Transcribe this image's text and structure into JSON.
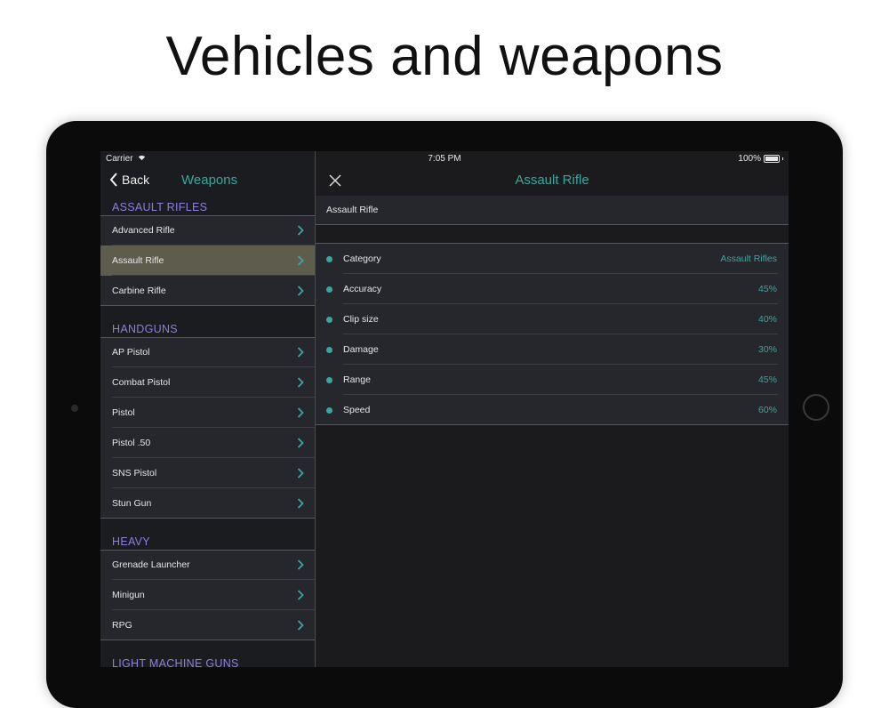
{
  "headline": "Vehicles and weapons",
  "status": {
    "carrier": "Carrier",
    "time": "7:05 PM",
    "battery": "100%"
  },
  "master": {
    "back_label": "Back",
    "title": "Weapons",
    "sections": [
      {
        "header": "ASSAULT RIFLES",
        "items": [
          "Advanced Rifle",
          "Assault Rifle",
          "Carbine Rifle"
        ],
        "selected": "Assault Rifle"
      },
      {
        "header": "HANDGUNS",
        "items": [
          "AP Pistol",
          "Combat Pistol",
          "Pistol",
          "Pistol .50",
          "SNS Pistol",
          "Stun Gun"
        ]
      },
      {
        "header": "HEAVY",
        "items": [
          "Grenade Launcher",
          "Minigun",
          "RPG"
        ]
      },
      {
        "header": "LIGHT MACHINE GUNS",
        "items": []
      }
    ]
  },
  "detail": {
    "title": "Assault Rifle",
    "name": "Assault Rifle",
    "stats": [
      {
        "label": "Category",
        "value": "Assault Rifles"
      },
      {
        "label": "Accuracy",
        "value": "45%"
      },
      {
        "label": "Clip size",
        "value": "40%"
      },
      {
        "label": "Damage",
        "value": "30%"
      },
      {
        "label": "Range",
        "value": "45%"
      },
      {
        "label": "Speed",
        "value": "60%"
      }
    ]
  },
  "colors": {
    "accent": "#3aa6a0",
    "section": "#8e7ee0",
    "selected": "#5e5c4d"
  },
  "icons": [
    "wifi-icon",
    "battery-icon",
    "back-chevron-icon",
    "close-icon",
    "chevron-right-icon"
  ]
}
